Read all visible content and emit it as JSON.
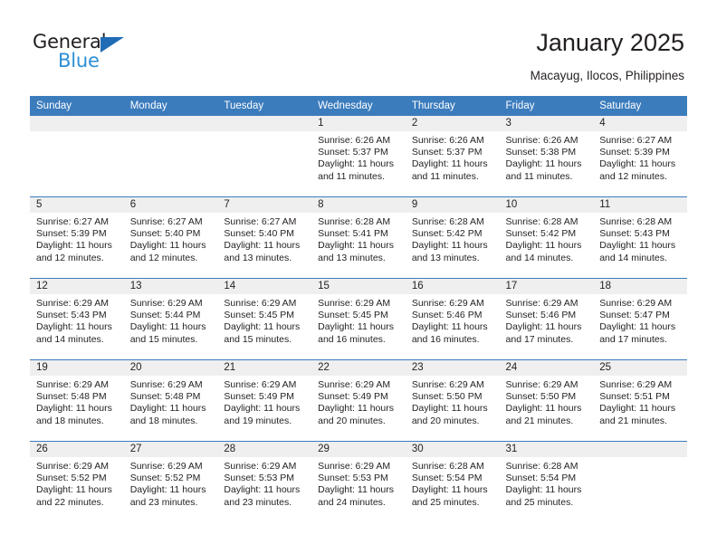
{
  "brand": {
    "word_one": "General",
    "word_two": "Blue",
    "triangle_icon": "blue-triangle-icon",
    "accent_color": "#1f6cb5",
    "secondary_color": "#2d8fd5"
  },
  "header": {
    "title": "January 2025",
    "subtitle": "Macayug, Ilocos, Philippines"
  },
  "theme": {
    "header_row_color": "#3b7cbd",
    "daynum_band_color": "#efefef",
    "text_color": "#231f20"
  },
  "labels": {
    "sunrise_prefix": "Sunrise:",
    "sunset_prefix": "Sunset:",
    "daylight_prefix": "Daylight:"
  },
  "weekday_headers": [
    "Sunday",
    "Monday",
    "Tuesday",
    "Wednesday",
    "Thursday",
    "Friday",
    "Saturday"
  ],
  "weeks": [
    [
      {
        "day": "",
        "empty": true,
        "sunrise": "",
        "sunset": "",
        "daylight_line1": "",
        "daylight_line2": ""
      },
      {
        "day": "",
        "empty": true,
        "sunrise": "",
        "sunset": "",
        "daylight_line1": "",
        "daylight_line2": ""
      },
      {
        "day": "",
        "empty": true,
        "sunrise": "",
        "sunset": "",
        "daylight_line1": "",
        "daylight_line2": ""
      },
      {
        "day": "1",
        "empty": false,
        "sunrise": "Sunrise: 6:26 AM",
        "sunset": "Sunset: 5:37 PM",
        "daylight_line1": "Daylight: 11 hours",
        "daylight_line2": "and 11 minutes."
      },
      {
        "day": "2",
        "empty": false,
        "sunrise": "Sunrise: 6:26 AM",
        "sunset": "Sunset: 5:37 PM",
        "daylight_line1": "Daylight: 11 hours",
        "daylight_line2": "and 11 minutes."
      },
      {
        "day": "3",
        "empty": false,
        "sunrise": "Sunrise: 6:26 AM",
        "sunset": "Sunset: 5:38 PM",
        "daylight_line1": "Daylight: 11 hours",
        "daylight_line2": "and 11 minutes."
      },
      {
        "day": "4",
        "empty": false,
        "sunrise": "Sunrise: 6:27 AM",
        "sunset": "Sunset: 5:39 PM",
        "daylight_line1": "Daylight: 11 hours",
        "daylight_line2": "and 12 minutes."
      }
    ],
    [
      {
        "day": "5",
        "empty": false,
        "sunrise": "Sunrise: 6:27 AM",
        "sunset": "Sunset: 5:39 PM",
        "daylight_line1": "Daylight: 11 hours",
        "daylight_line2": "and 12 minutes."
      },
      {
        "day": "6",
        "empty": false,
        "sunrise": "Sunrise: 6:27 AM",
        "sunset": "Sunset: 5:40 PM",
        "daylight_line1": "Daylight: 11 hours",
        "daylight_line2": "and 12 minutes."
      },
      {
        "day": "7",
        "empty": false,
        "sunrise": "Sunrise: 6:27 AM",
        "sunset": "Sunset: 5:40 PM",
        "daylight_line1": "Daylight: 11 hours",
        "daylight_line2": "and 13 minutes."
      },
      {
        "day": "8",
        "empty": false,
        "sunrise": "Sunrise: 6:28 AM",
        "sunset": "Sunset: 5:41 PM",
        "daylight_line1": "Daylight: 11 hours",
        "daylight_line2": "and 13 minutes."
      },
      {
        "day": "9",
        "empty": false,
        "sunrise": "Sunrise: 6:28 AM",
        "sunset": "Sunset: 5:42 PM",
        "daylight_line1": "Daylight: 11 hours",
        "daylight_line2": "and 13 minutes."
      },
      {
        "day": "10",
        "empty": false,
        "sunrise": "Sunrise: 6:28 AM",
        "sunset": "Sunset: 5:42 PM",
        "daylight_line1": "Daylight: 11 hours",
        "daylight_line2": "and 14 minutes."
      },
      {
        "day": "11",
        "empty": false,
        "sunrise": "Sunrise: 6:28 AM",
        "sunset": "Sunset: 5:43 PM",
        "daylight_line1": "Daylight: 11 hours",
        "daylight_line2": "and 14 minutes."
      }
    ],
    [
      {
        "day": "12",
        "empty": false,
        "sunrise": "Sunrise: 6:29 AM",
        "sunset": "Sunset: 5:43 PM",
        "daylight_line1": "Daylight: 11 hours",
        "daylight_line2": "and 14 minutes."
      },
      {
        "day": "13",
        "empty": false,
        "sunrise": "Sunrise: 6:29 AM",
        "sunset": "Sunset: 5:44 PM",
        "daylight_line1": "Daylight: 11 hours",
        "daylight_line2": "and 15 minutes."
      },
      {
        "day": "14",
        "empty": false,
        "sunrise": "Sunrise: 6:29 AM",
        "sunset": "Sunset: 5:45 PM",
        "daylight_line1": "Daylight: 11 hours",
        "daylight_line2": "and 15 minutes."
      },
      {
        "day": "15",
        "empty": false,
        "sunrise": "Sunrise: 6:29 AM",
        "sunset": "Sunset: 5:45 PM",
        "daylight_line1": "Daylight: 11 hours",
        "daylight_line2": "and 16 minutes."
      },
      {
        "day": "16",
        "empty": false,
        "sunrise": "Sunrise: 6:29 AM",
        "sunset": "Sunset: 5:46 PM",
        "daylight_line1": "Daylight: 11 hours",
        "daylight_line2": "and 16 minutes."
      },
      {
        "day": "17",
        "empty": false,
        "sunrise": "Sunrise: 6:29 AM",
        "sunset": "Sunset: 5:46 PM",
        "daylight_line1": "Daylight: 11 hours",
        "daylight_line2": "and 17 minutes."
      },
      {
        "day": "18",
        "empty": false,
        "sunrise": "Sunrise: 6:29 AM",
        "sunset": "Sunset: 5:47 PM",
        "daylight_line1": "Daylight: 11 hours",
        "daylight_line2": "and 17 minutes."
      }
    ],
    [
      {
        "day": "19",
        "empty": false,
        "sunrise": "Sunrise: 6:29 AM",
        "sunset": "Sunset: 5:48 PM",
        "daylight_line1": "Daylight: 11 hours",
        "daylight_line2": "and 18 minutes."
      },
      {
        "day": "20",
        "empty": false,
        "sunrise": "Sunrise: 6:29 AM",
        "sunset": "Sunset: 5:48 PM",
        "daylight_line1": "Daylight: 11 hours",
        "daylight_line2": "and 18 minutes."
      },
      {
        "day": "21",
        "empty": false,
        "sunrise": "Sunrise: 6:29 AM",
        "sunset": "Sunset: 5:49 PM",
        "daylight_line1": "Daylight: 11 hours",
        "daylight_line2": "and 19 minutes."
      },
      {
        "day": "22",
        "empty": false,
        "sunrise": "Sunrise: 6:29 AM",
        "sunset": "Sunset: 5:49 PM",
        "daylight_line1": "Daylight: 11 hours",
        "daylight_line2": "and 20 minutes."
      },
      {
        "day": "23",
        "empty": false,
        "sunrise": "Sunrise: 6:29 AM",
        "sunset": "Sunset: 5:50 PM",
        "daylight_line1": "Daylight: 11 hours",
        "daylight_line2": "and 20 minutes."
      },
      {
        "day": "24",
        "empty": false,
        "sunrise": "Sunrise: 6:29 AM",
        "sunset": "Sunset: 5:50 PM",
        "daylight_line1": "Daylight: 11 hours",
        "daylight_line2": "and 21 minutes."
      },
      {
        "day": "25",
        "empty": false,
        "sunrise": "Sunrise: 6:29 AM",
        "sunset": "Sunset: 5:51 PM",
        "daylight_line1": "Daylight: 11 hours",
        "daylight_line2": "and 21 minutes."
      }
    ],
    [
      {
        "day": "26",
        "empty": false,
        "sunrise": "Sunrise: 6:29 AM",
        "sunset": "Sunset: 5:52 PM",
        "daylight_line1": "Daylight: 11 hours",
        "daylight_line2": "and 22 minutes."
      },
      {
        "day": "27",
        "empty": false,
        "sunrise": "Sunrise: 6:29 AM",
        "sunset": "Sunset: 5:52 PM",
        "daylight_line1": "Daylight: 11 hours",
        "daylight_line2": "and 23 minutes."
      },
      {
        "day": "28",
        "empty": false,
        "sunrise": "Sunrise: 6:29 AM",
        "sunset": "Sunset: 5:53 PM",
        "daylight_line1": "Daylight: 11 hours",
        "daylight_line2": "and 23 minutes."
      },
      {
        "day": "29",
        "empty": false,
        "sunrise": "Sunrise: 6:29 AM",
        "sunset": "Sunset: 5:53 PM",
        "daylight_line1": "Daylight: 11 hours",
        "daylight_line2": "and 24 minutes."
      },
      {
        "day": "30",
        "empty": false,
        "sunrise": "Sunrise: 6:28 AM",
        "sunset": "Sunset: 5:54 PM",
        "daylight_line1": "Daylight: 11 hours",
        "daylight_line2": "and 25 minutes."
      },
      {
        "day": "31",
        "empty": false,
        "sunrise": "Sunrise: 6:28 AM",
        "sunset": "Sunset: 5:54 PM",
        "daylight_line1": "Daylight: 11 hours",
        "daylight_line2": "and 25 minutes."
      },
      {
        "day": "",
        "empty": true,
        "sunrise": "",
        "sunset": "",
        "daylight_line1": "",
        "daylight_line2": ""
      }
    ]
  ]
}
